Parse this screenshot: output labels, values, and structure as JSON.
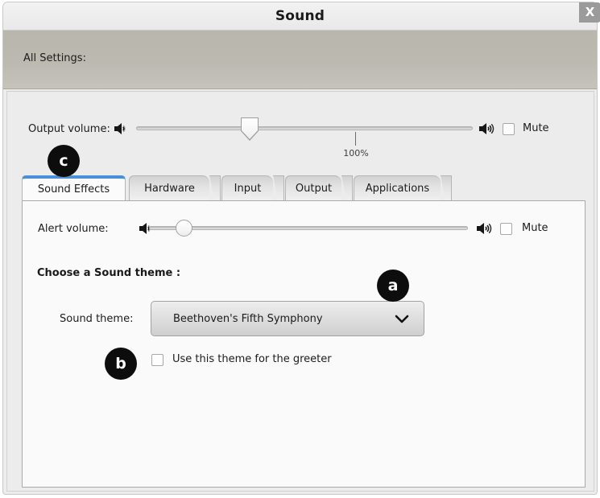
{
  "window": {
    "title": "Sound",
    "close_label": "X"
  },
  "toolbar": {
    "all_settings_label": "All Settings:"
  },
  "output_volume": {
    "label": "Output volume:",
    "low_speaker_icon": "speaker-low-icon",
    "high_speaker_icon": "speaker-high-icon",
    "mute_label": "Mute",
    "mute_checked": false,
    "value_percent": 42,
    "tick_label": "100%"
  },
  "tabs": [
    {
      "label": "Sound Effects",
      "active": true
    },
    {
      "label": "Hardware",
      "active": false
    },
    {
      "label": "Input",
      "active": false
    },
    {
      "label": "Output",
      "active": false
    },
    {
      "label": "Applications",
      "active": false
    }
  ],
  "sound_effects": {
    "alert_volume": {
      "label": "Alert volume:",
      "low_speaker_icon": "speaker-low-icon",
      "high_speaker_icon": "speaker-high-icon",
      "mute_label": "Mute",
      "mute_checked": false,
      "value_percent": 11
    },
    "choose_theme_heading": "Choose a Sound theme :",
    "sound_theme": {
      "label": "Sound theme:",
      "selected": "Beethoven's Fifth Symphony",
      "chevron_icon": "chevron-down-icon"
    },
    "greeter_checkbox": {
      "label": "Use this theme for the greeter",
      "checked": false
    }
  },
  "annotations": [
    {
      "id": "a",
      "label": "a"
    },
    {
      "id": "b",
      "label": "b"
    },
    {
      "id": "c",
      "label": "c"
    }
  ],
  "colors": {
    "accent_tab": "#4a90d9",
    "toolbar_bg": "#bbb9b0",
    "window_bg": "#ececec",
    "panel_bg": "#fafafa",
    "marker_bg": "#0d0d0d"
  }
}
